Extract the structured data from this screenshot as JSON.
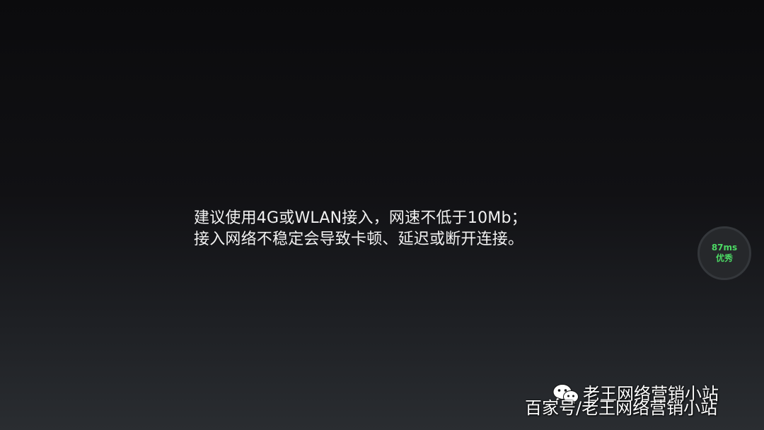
{
  "notice": {
    "lines": [
      "建议使用4G或WLAN接入，网速不低于10Mb；",
      "接入网络不稳定会导致卡顿、延迟或断开连接。"
    ]
  },
  "latency": {
    "value": "87ms",
    "quality": "优秀",
    "color": "#4cd964"
  },
  "watermarks": {
    "wechat": "老王网络营销小站",
    "baijiahao": "百家号/老王网络营销小站",
    "icon": "wechat-icon"
  }
}
